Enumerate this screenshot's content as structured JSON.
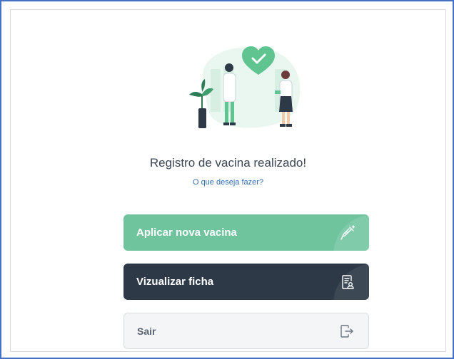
{
  "dialog": {
    "title": "Registro de vacina realizado!",
    "subtitle": "O que deseja fazer?"
  },
  "actions": {
    "apply_label": "Aplicar nova vacina",
    "view_label": "Vizualizar ficha",
    "exit_label": "Sair"
  },
  "icons": {
    "apply": "syringe-icon",
    "view": "patient-record-icon",
    "exit": "logout-icon",
    "illustration": "vaccination-illustration"
  },
  "colors": {
    "primary": "#6fc49e",
    "dark": "#2d3947",
    "light": "#f4f5f7",
    "frame": "#4472c4"
  }
}
